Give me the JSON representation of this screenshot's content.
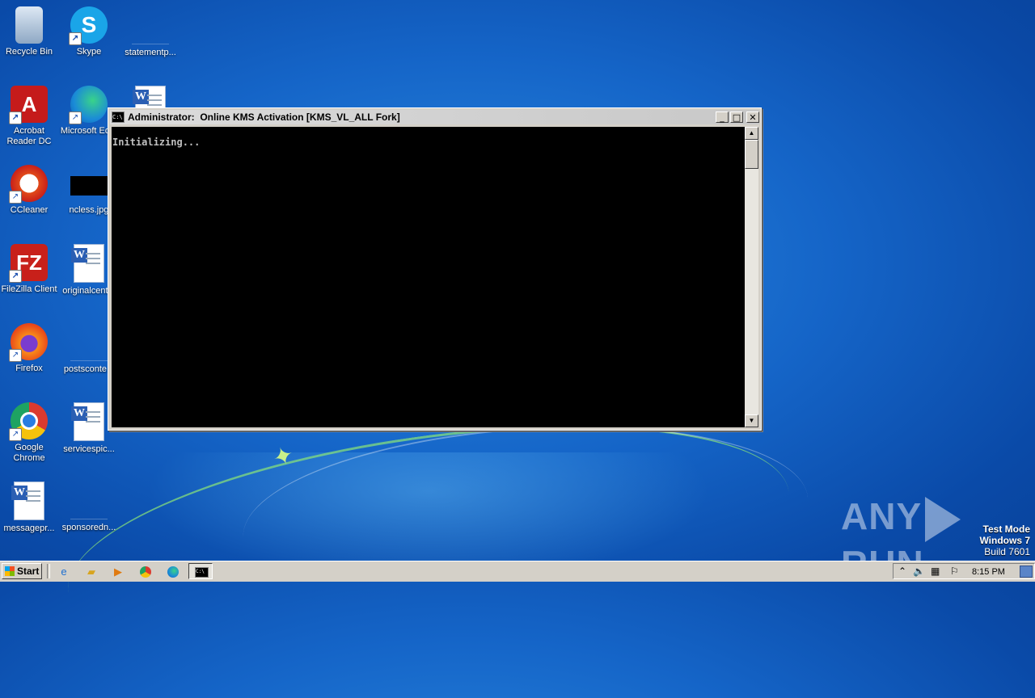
{
  "desktop": {
    "icons": [
      {
        "label": "Recycle Bin",
        "icon": "recycle-bin-icon"
      },
      {
        "label": "Skype",
        "icon": "skype-icon"
      },
      {
        "label": "statementp...",
        "icon": "file-icon"
      },
      {
        "label": "Acrobat Reader DC",
        "icon": "acrobat-reader-icon"
      },
      {
        "label": "Microsoft Ed...",
        "icon": "edge-icon"
      },
      {
        "label": "CCleaner",
        "icon": "ccleaner-icon"
      },
      {
        "label": "ncless.jpg",
        "icon": "image-file-icon"
      },
      {
        "label": "FileZilla Client",
        "icon": "filezilla-icon"
      },
      {
        "label": "originalcent...",
        "icon": "word-doc-icon"
      },
      {
        "label": "Firefox",
        "icon": "firefox-icon"
      },
      {
        "label": "postsconte...",
        "icon": "file-icon"
      },
      {
        "label": "Google Chrome",
        "icon": "chrome-icon"
      },
      {
        "label": "servicespic...",
        "icon": "word-doc-icon"
      },
      {
        "label": "messagepr...",
        "icon": "word-doc-icon"
      },
      {
        "label": "sponsoredn...",
        "icon": "file-icon"
      }
    ]
  },
  "console_window": {
    "title": "Administrator:  Online KMS Activation [KMS_VL_ALL Fork]",
    "icon_text": "C:\\",
    "output": "Initializing...",
    "minimize": "_",
    "maximize": "□",
    "close": "✕",
    "scroll_up": "▲",
    "scroll_down": "▼"
  },
  "watermark": {
    "left": "ANY",
    "right": "RUN",
    "test_mode": "Test Mode",
    "os": "Windows 7",
    "build": "Build 7601"
  },
  "taskbar": {
    "start_label": "Start",
    "quick_launch": [
      "internet-explorer-icon",
      "explorer-icon",
      "media-player-icon",
      "chrome-icon",
      "edge-icon"
    ],
    "active_task_icon": "C:\\",
    "tray_chevron": "⌃",
    "clock": "8:15 PM"
  }
}
